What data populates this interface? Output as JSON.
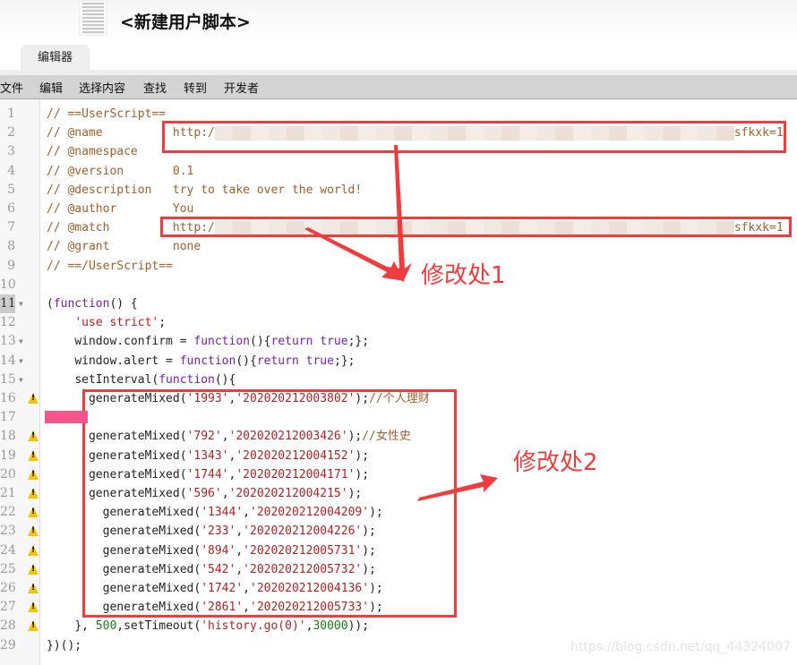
{
  "header": {
    "title": "<新建用户脚本>"
  },
  "tabs": [
    {
      "label": "编辑器",
      "active": true
    }
  ],
  "menu": [
    "文件",
    "编辑",
    "选择内容",
    "查找",
    "转到",
    "开发者"
  ],
  "editor": {
    "active_line": 11,
    "lines": [
      {
        "n": "1",
        "comment": "// ==UserScript=="
      },
      {
        "n": "2",
        "comment": "// @name",
        "value_prefix": "http:/",
        "value_suffix": "sfkxk=1",
        "redacted": true
      },
      {
        "n": "3",
        "comment": "// @namespace"
      },
      {
        "n": "4",
        "comment": "// @version",
        "value": "0.1"
      },
      {
        "n": "5",
        "comment": "// @description",
        "value": "try to take over the world!"
      },
      {
        "n": "6",
        "comment": "// @author",
        "value": "You"
      },
      {
        "n": "7",
        "comment": "// @match",
        "value_prefix": "http:/",
        "value_suffix": "sfkxk=1",
        "redacted": true
      },
      {
        "n": "8",
        "comment": "// @grant",
        "value": "none"
      },
      {
        "n": "9",
        "comment": "// ==/UserScript=="
      },
      {
        "n": "10"
      },
      {
        "n": "11",
        "text": "(function() {"
      },
      {
        "n": "12",
        "text": "'use strict';"
      },
      {
        "n": "13",
        "text": "window.confirm = function(){return true;};"
      },
      {
        "n": "14",
        "text": "window.alert = function(){return true;};"
      },
      {
        "n": "15",
        "text": "setInterval(function(){"
      },
      {
        "n": "16",
        "fn": "generateMixed",
        "a": "1993",
        "b": "202020212003802",
        "comment": "//个人理财"
      },
      {
        "n": "17"
      },
      {
        "n": "18",
        "fn": "generateMixed",
        "a": "792",
        "b": "202020212003426",
        "comment": "//女性史"
      },
      {
        "n": "19",
        "fn": "generateMixed",
        "a": "1343",
        "b": "202020212004152"
      },
      {
        "n": "20",
        "fn": "generateMixed",
        "a": "1744",
        "b": "202020212004171"
      },
      {
        "n": "21",
        "fn": "generateMixed",
        "a": "596",
        "b": "202020212004215"
      },
      {
        "n": "22",
        "fn": "generateMixed",
        "a": "1344",
        "b": "202020212004209"
      },
      {
        "n": "23",
        "fn": "generateMixed",
        "a": "233",
        "b": "202020212004226"
      },
      {
        "n": "24",
        "fn": "generateMixed",
        "a": "894",
        "b": "202020212005731"
      },
      {
        "n": "25",
        "fn": "generateMixed",
        "a": "542",
        "b": "202020212005732"
      },
      {
        "n": "26",
        "fn": "generateMixed",
        "a": "1742",
        "b": "202020212004136"
      },
      {
        "n": "27",
        "fn": "generateMixed",
        "a": "2861",
        "b": "202020212005733"
      },
      {
        "n": "28",
        "text": "}, 500,setTimeout('history.go(0)',30000));"
      },
      {
        "n": "29",
        "text": "})();"
      }
    ]
  },
  "annotations": {
    "mod1": "修改处1",
    "mod2": "修改处2"
  },
  "watermark": "https://blog.csdn.net/qq_44324007",
  "colors": {
    "annotation_red": "#f03c3c",
    "comment": "#a0602a",
    "keyword": "#7a1fa2",
    "string": "#b22222"
  }
}
